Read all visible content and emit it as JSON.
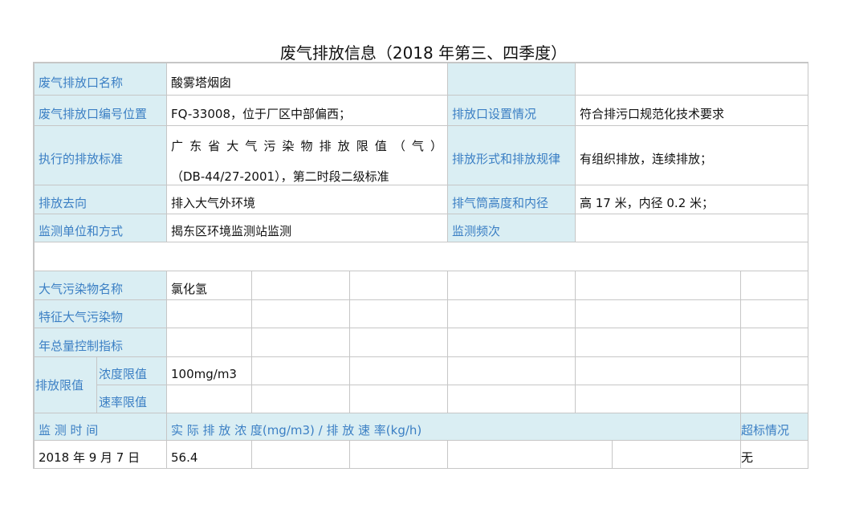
{
  "title": "废气排放信息（2018 年第三、四季度）",
  "info": {
    "outlet_name_label": "废气排放口名称",
    "outlet_name": "酸雾塔烟囱",
    "outlet_code_label": "废气排放口编号位置",
    "outlet_code": "FQ-33008，位于厂区中部偏西；",
    "outlet_setup_label": "排放口设置情况",
    "outlet_setup": "符合排污口规范化技术要求",
    "standard_label": "执行的排放标准",
    "standard_line1": "广东省大气污染物排放限值（气）",
    "standard_line2": "（DB-44/27-2001），第二时段二级标准",
    "form_label": "排放形式和排放规律",
    "form": "有组织排放，连续排放；",
    "destination_label": "排放去向",
    "destination": "排入大气外环境",
    "stack_label": "排气筒高度和内径",
    "stack": "高 17 米，内径 0.2 米；",
    "monitor_unit_label": "监测单位和方式",
    "monitor_unit": "揭东区环境监测站监测",
    "monitor_freq_label": "监测频次",
    "monitor_freq": ""
  },
  "pollutant": {
    "name_label": "大气污染物名称",
    "name": "氯化氢",
    "special_label": "特征大气污染物",
    "annual_label": "年总量控制指标",
    "limit_label": "排放限值",
    "conc_limit_label": "浓度限值",
    "conc_limit": "100mg/m3",
    "rate_limit_label": "速率限值"
  },
  "monitoring": {
    "time_label": "监 测 时 间",
    "emission_label": "实 际 排 放 浓 度(mg/m3) / 排 放 速 率(kg/h)",
    "exceed_label": "超标情况",
    "rows": [
      {
        "date": "2018 年 9 月 7 日",
        "value": "56.4",
        "exceed": "无"
      }
    ]
  }
}
